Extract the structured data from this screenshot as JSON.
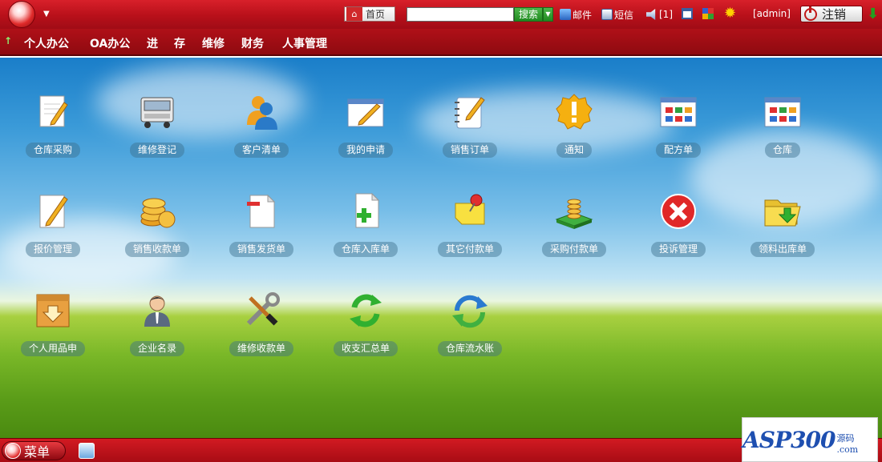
{
  "topbar": {
    "home_label": "首页",
    "search_value": "",
    "search_label": "搜索",
    "mail_label": "邮件",
    "sms_label": "短信",
    "volume_count": "[1]",
    "user_label": "[admin]",
    "logout_label": "注销"
  },
  "menu": {
    "items": [
      {
        "label": "个人办公"
      },
      {
        "label": "OA办公"
      },
      {
        "label": "进"
      },
      {
        "label": "存"
      },
      {
        "label": "维修"
      },
      {
        "label": "财务"
      },
      {
        "label": "人事管理"
      }
    ]
  },
  "desktop": {
    "icons": [
      {
        "label": "仓库采购",
        "icon": "document-pencil-icon"
      },
      {
        "label": "维修登记",
        "icon": "truck-icon"
      },
      {
        "label": "客户清单",
        "icon": "users-icon"
      },
      {
        "label": "我的申请",
        "icon": "notepad-icon"
      },
      {
        "label": "销售订单",
        "icon": "spiral-notebook-icon"
      },
      {
        "label": "通知",
        "icon": "exclamation-icon"
      },
      {
        "label": "配方单",
        "icon": "app-window-icon"
      },
      {
        "label": "仓库",
        "icon": "app-window-icon"
      },
      {
        "label": "报价管理",
        "icon": "document-pencil-icon"
      },
      {
        "label": "销售收款单",
        "icon": "coins-icon"
      },
      {
        "label": "销售发货单",
        "icon": "document-minus-icon"
      },
      {
        "label": "仓库入库单",
        "icon": "document-plus-icon"
      },
      {
        "label": "其它付款单",
        "icon": "pinned-note-icon"
      },
      {
        "label": "采购付款单",
        "icon": "coins-stack-icon"
      },
      {
        "label": "投诉管理",
        "icon": "close-circle-icon"
      },
      {
        "label": "领料出库单",
        "icon": "folder-arrow-icon"
      },
      {
        "label": "个人用品申",
        "icon": "box-icon"
      },
      {
        "label": "企业名录",
        "icon": "person-icon"
      },
      {
        "label": "维修收款单",
        "icon": "tools-icon"
      },
      {
        "label": "收支汇总单",
        "icon": "refresh-green-icon"
      },
      {
        "label": "仓库流水账",
        "icon": "refresh-blue-icon"
      }
    ]
  },
  "taskbar": {
    "start_label": "菜单"
  },
  "watermark": {
    "text": "ASP300",
    "sub": "源码 .com"
  }
}
